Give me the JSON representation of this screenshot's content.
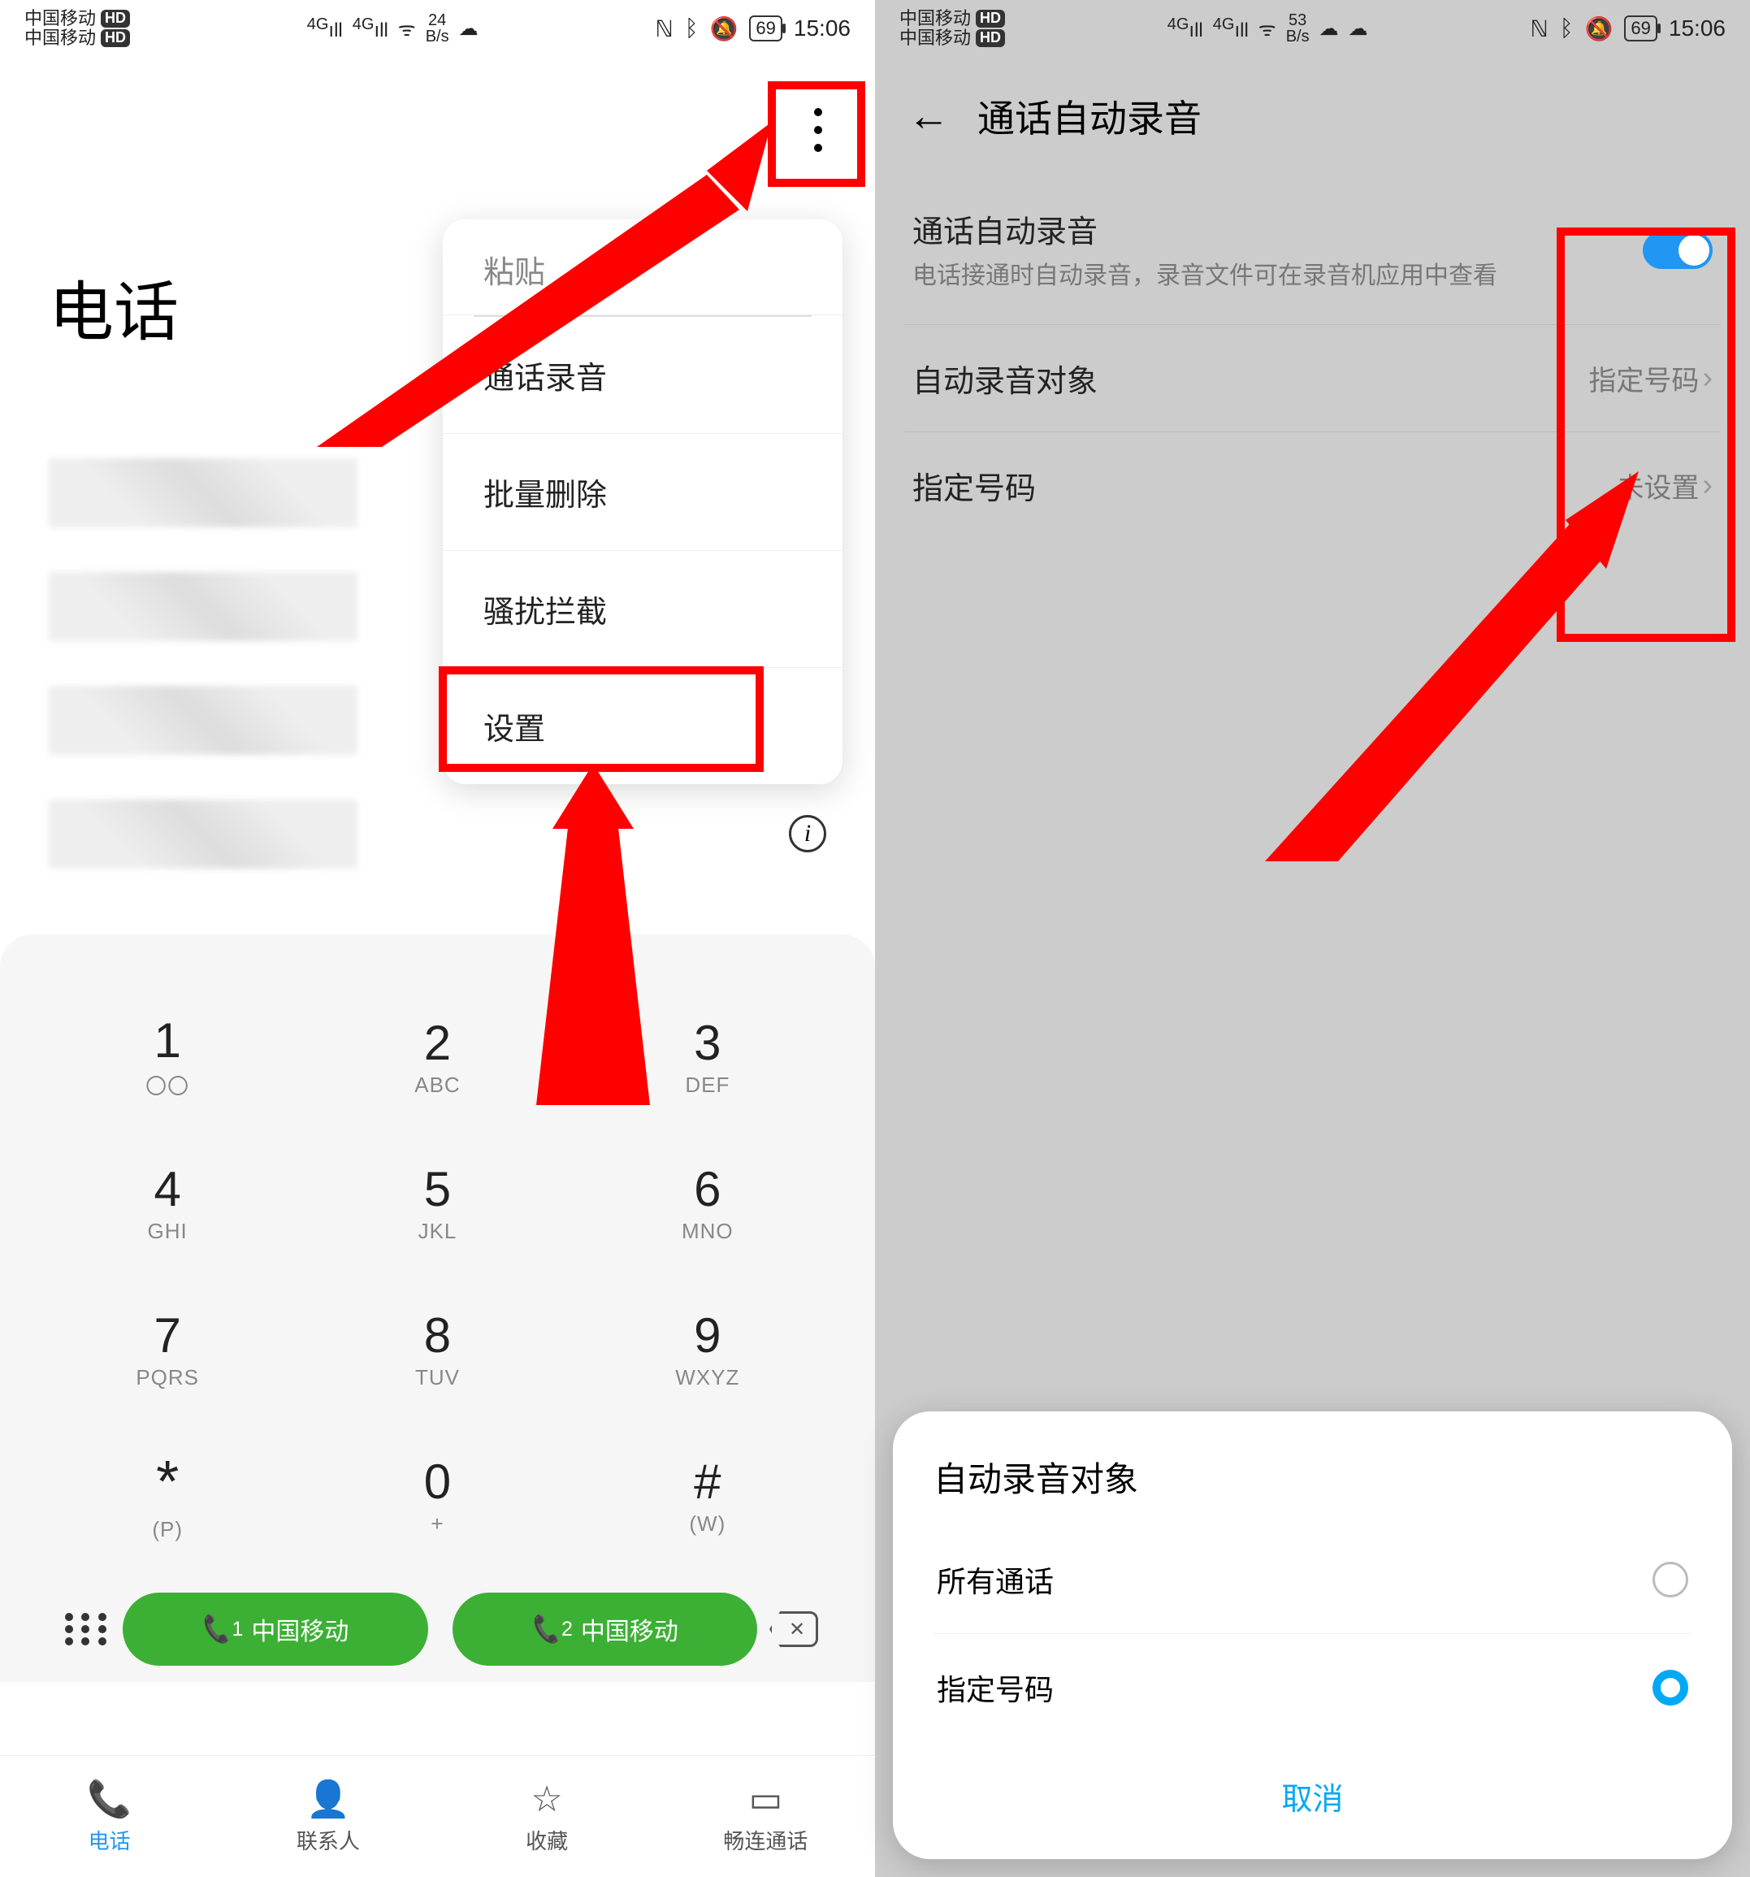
{
  "status": {
    "carrier": "中国移动",
    "hd_badge": "HD",
    "net": "4G",
    "wifi_glyph": "ᯤ",
    "speed_left": {
      "num": "24",
      "unit": "B/s"
    },
    "speed_right": {
      "num": "53",
      "unit": "B/s"
    },
    "battery": "69",
    "time": "15:06"
  },
  "left": {
    "app_title": "电话",
    "context_menu": {
      "paste": "粘贴",
      "items": [
        "通话录音",
        "批量删除",
        "骚扰拦截",
        "设置"
      ]
    },
    "dialpad": [
      {
        "num": "1",
        "sub": "〇〇"
      },
      {
        "num": "2",
        "sub": "ABC"
      },
      {
        "num": "3",
        "sub": "DEF"
      },
      {
        "num": "4",
        "sub": "GHI"
      },
      {
        "num": "5",
        "sub": "JKL"
      },
      {
        "num": "6",
        "sub": "MNO"
      },
      {
        "num": "7",
        "sub": "PQRS"
      },
      {
        "num": "8",
        "sub": "TUV"
      },
      {
        "num": "9",
        "sub": "WXYZ"
      },
      {
        "num": "*",
        "sub": "(P)"
      },
      {
        "num": "0",
        "sub": "+"
      },
      {
        "num": "#",
        "sub": "(W)"
      }
    ],
    "sim1": {
      "label": "中国移动",
      "badge": "1"
    },
    "sim2": {
      "label": "中国移动",
      "badge": "2"
    },
    "tabs": [
      {
        "label": "电话"
      },
      {
        "label": "联系人"
      },
      {
        "label": "收藏"
      },
      {
        "label": "畅连通话"
      }
    ]
  },
  "right": {
    "page_title": "通话自动录音",
    "auto_record": {
      "label": "通话自动录音",
      "desc": "电话接通时自动录音，录音文件可在录音机应用中查看"
    },
    "rows": [
      {
        "label": "自动录音对象",
        "value": "指定号码"
      },
      {
        "label": "指定号码",
        "value": "未设置"
      }
    ],
    "sheet": {
      "title": "自动录音对象",
      "options": [
        "所有通话",
        "指定号码"
      ],
      "cancel": "取消"
    }
  }
}
